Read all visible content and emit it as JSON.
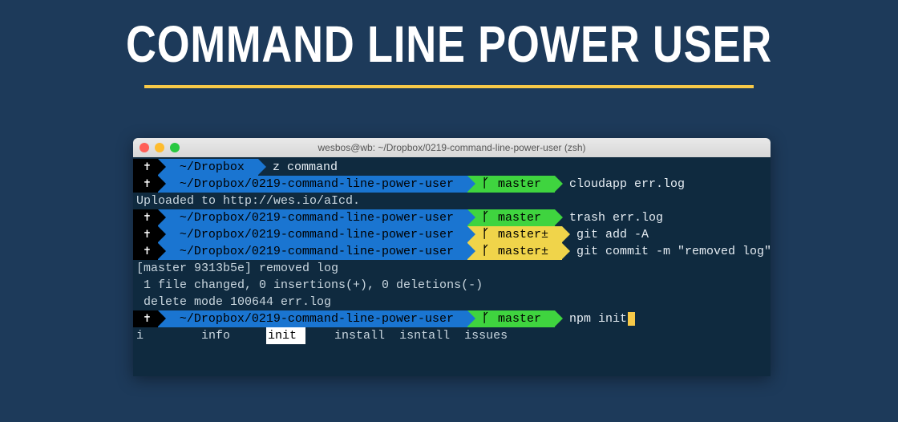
{
  "title": "COMMAND LINE POWER USER",
  "window_title": "wesbos@wb: ~/Dropbox/0219-command-line-power-user (zsh)",
  "lines": [
    {
      "type": "prompt",
      "path": "~/Dropbox",
      "branch": null,
      "branch_style": null,
      "command": "z command"
    },
    {
      "type": "prompt",
      "path": "~/Dropbox/0219-command-line-power-user",
      "branch": "master",
      "branch_style": "green",
      "command": "cloudapp err.log"
    },
    {
      "type": "output",
      "text": "Uploaded to http://wes.io/aIcd."
    },
    {
      "type": "prompt",
      "path": "~/Dropbox/0219-command-line-power-user",
      "branch": "master",
      "branch_style": "green",
      "command": "trash err.log"
    },
    {
      "type": "prompt",
      "path": "~/Dropbox/0219-command-line-power-user",
      "branch": "master±",
      "branch_style": "yellow",
      "command": "git add -A"
    },
    {
      "type": "prompt",
      "path": "~/Dropbox/0219-command-line-power-user",
      "branch": "master±",
      "branch_style": "yellow",
      "command": "git commit -m \"removed log\""
    },
    {
      "type": "output",
      "text": "[master 9313b5e] removed log"
    },
    {
      "type": "output",
      "text": " 1 file changed, 0 insertions(+), 0 deletions(-)"
    },
    {
      "type": "output",
      "text": " delete mode 100644 err.log"
    },
    {
      "type": "prompt",
      "path": "~/Dropbox/0219-command-line-power-user",
      "branch": "master",
      "branch_style": "green",
      "command": "npm init",
      "cursor": true
    }
  ],
  "completions": {
    "items": [
      "i",
      "info",
      "init",
      "install",
      "isntall",
      "issues"
    ],
    "selected": "init"
  },
  "branch_symbol": "ᚴ",
  "prompt_symbol": "✝"
}
